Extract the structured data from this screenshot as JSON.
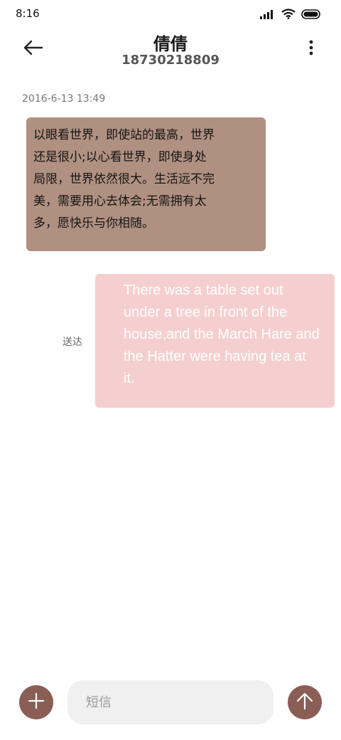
{
  "status_bar": {
    "time": "8:16",
    "icons": [
      "signal-icon",
      "wifi-icon",
      "battery-icon"
    ]
  },
  "header": {
    "contact_name": "倩倩",
    "contact_number": "18730218809",
    "icons": [
      "back-arrow-icon",
      "more-vertical-icon"
    ]
  },
  "conversation": {
    "timestamp": "2016-6-13 13:49",
    "incoming": {
      "lines": [
        "以眼看世界，即使站的最高，世界",
        "还是很小;以心看世界，即使身处",
        "局限，世界依然很大。生活远不完",
        "美，需要用心去体会;无需拥有太",
        "多，愿快乐与你相随。"
      ]
    },
    "outgoing": {
      "lines": [
        "There was a table set out",
        "under a tree in front of the",
        "house,and the March Hare and",
        "the Hatter were having tea at",
        "it."
      ],
      "status": "送达"
    }
  },
  "composer": {
    "placeholder": "短信",
    "value": "",
    "icons": [
      "plus-icon",
      "send-arrow-icon"
    ]
  },
  "colors": {
    "incoming_bubble": "#b09080",
    "outgoing_bubble": "#f5cfcf",
    "accent": "#8a5e55",
    "input_bg": "#f0f0f0"
  }
}
